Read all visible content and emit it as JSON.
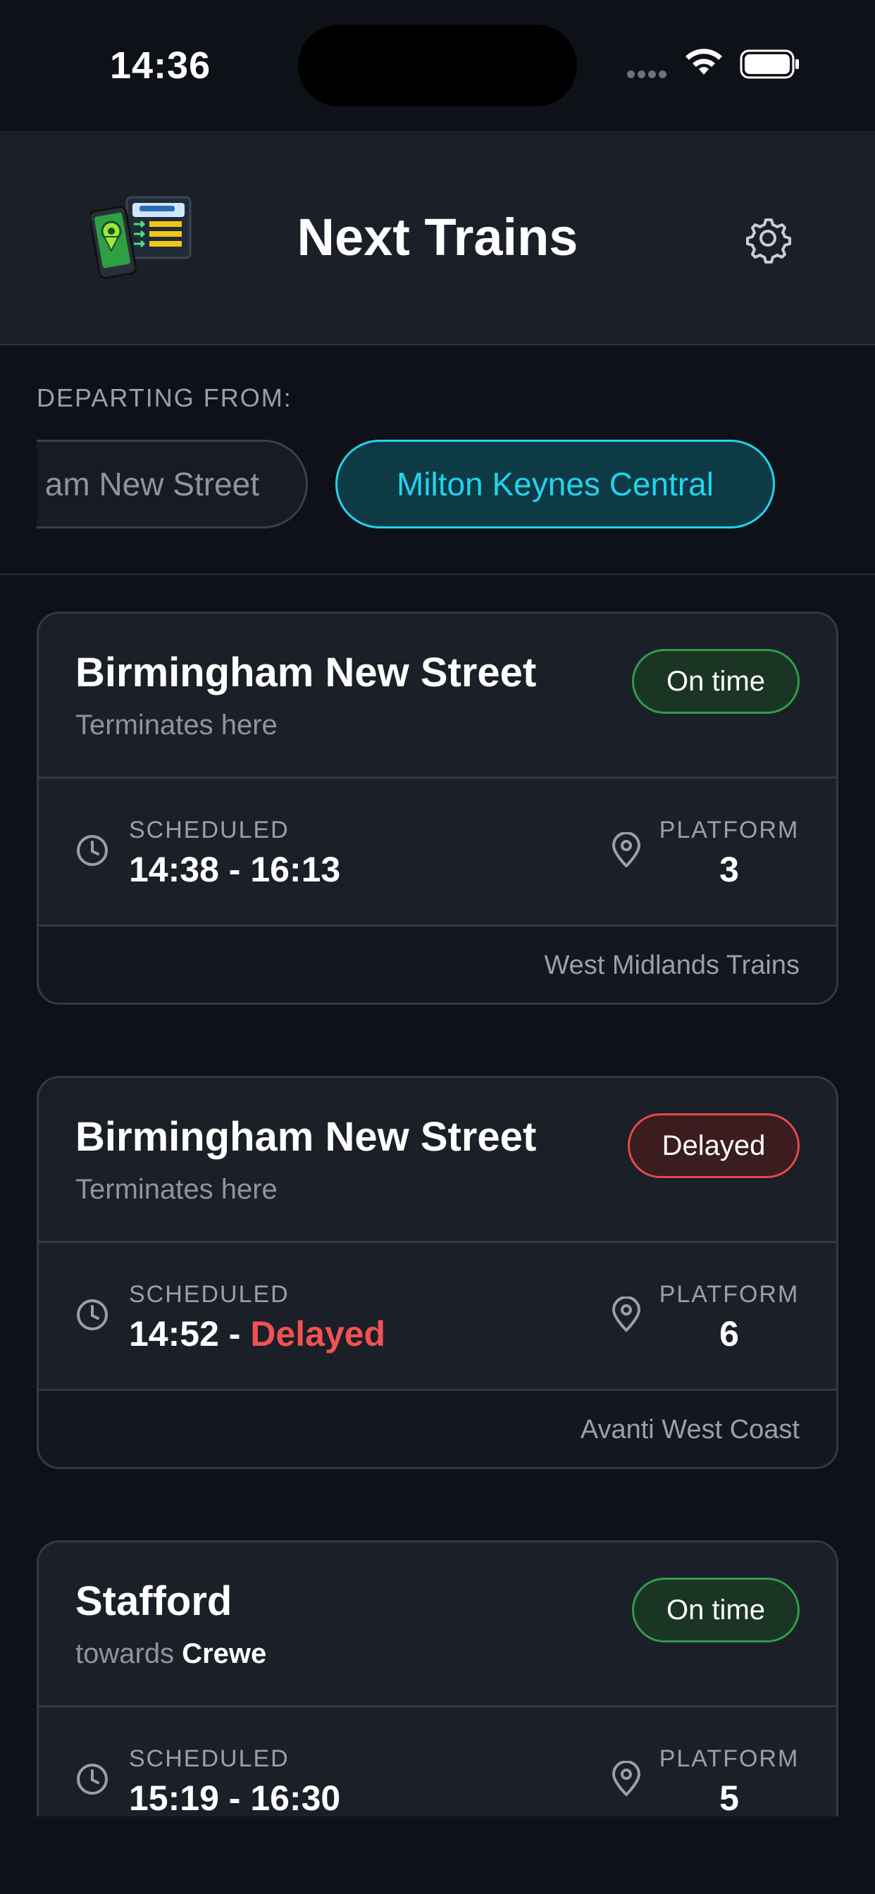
{
  "status_bar": {
    "time": "14:36"
  },
  "header": {
    "title": "Next Trains"
  },
  "departing": {
    "label": "DEPARTING FROM:",
    "stations": [
      "am New Street",
      "Milton Keynes Central"
    ],
    "selected": "Milton Keynes Central"
  },
  "colors": {
    "accent": "#22d3ee",
    "ontime": "#2f9e49",
    "delayed": "#e5484d"
  },
  "trains": [
    {
      "destination": "Birmingham New Street",
      "sub": "Terminates here",
      "status": "On time",
      "scheduled_label": "SCHEDULED",
      "time": "14:38 - 16:13",
      "platform_label": "PLATFORM",
      "platform": "3",
      "operator": "West Midlands Trains"
    },
    {
      "destination": "Birmingham New Street",
      "sub": "Terminates here",
      "status": "Delayed",
      "scheduled_label": "SCHEDULED",
      "time": "14:52 - ",
      "time_status": "Delayed",
      "platform_label": "PLATFORM",
      "platform": "6",
      "operator": "Avanti West Coast"
    },
    {
      "destination": "Stafford",
      "sub_prefix": "towards",
      "sub_strong": "Crewe",
      "status": "On time",
      "scheduled_label": "SCHEDULED",
      "time": "15:19 - 16:30",
      "platform_label": "PLATFORM",
      "platform": "5"
    }
  ]
}
